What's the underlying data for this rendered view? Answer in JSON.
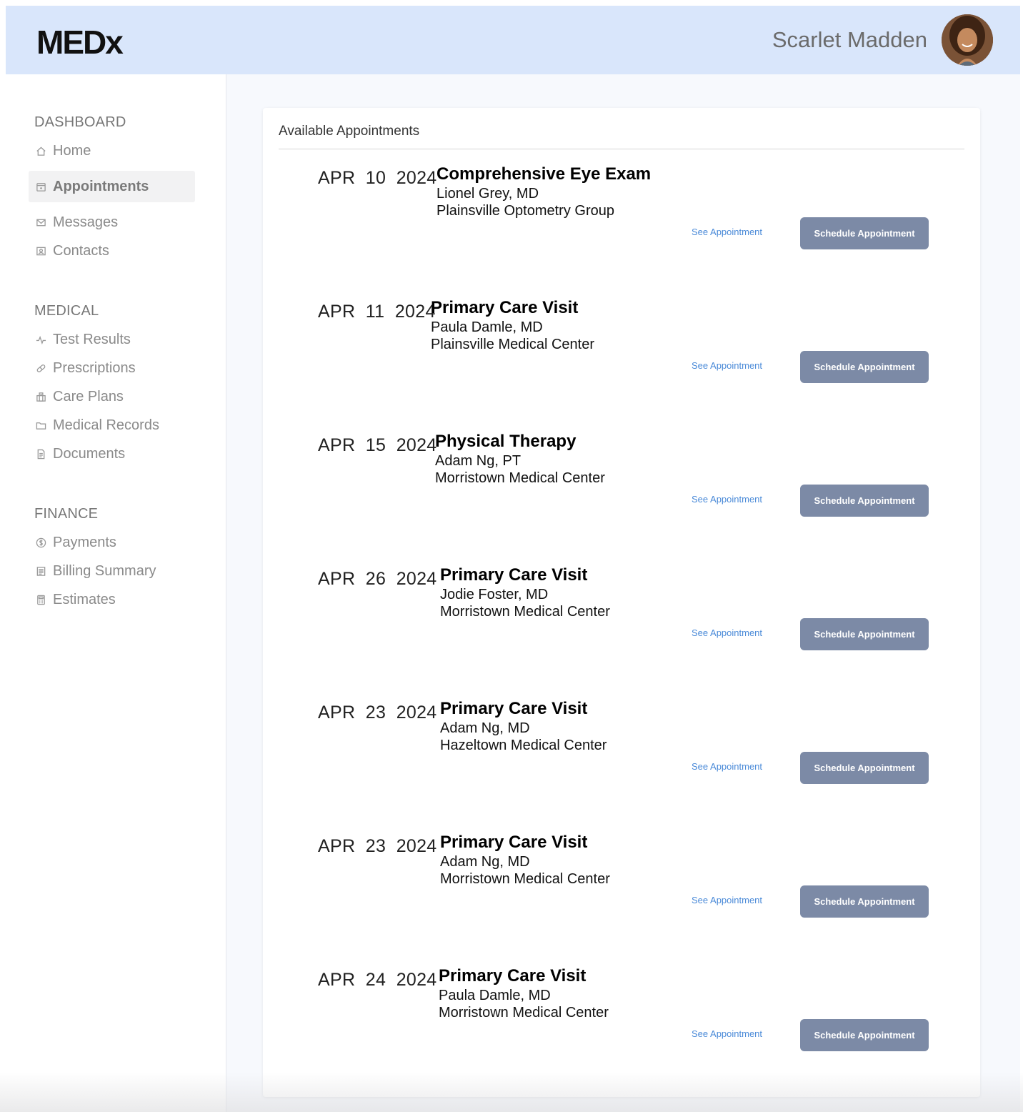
{
  "header": {
    "logo": "MEDx",
    "user_name": "Scarlet Madden",
    "avatar_icon": "user-avatar"
  },
  "sidebar": {
    "sections": [
      {
        "title": "DASHBOARD",
        "items": [
          {
            "label": "Home",
            "icon": "home-icon",
            "active": false
          },
          {
            "label": "Appointments",
            "icon": "calendar-icon",
            "active": true
          },
          {
            "label": "Messages",
            "icon": "mail-icon",
            "active": false
          },
          {
            "label": "Contacts",
            "icon": "contact-card-icon",
            "active": false
          }
        ]
      },
      {
        "title": "MEDICAL",
        "items": [
          {
            "label": "Test Results",
            "icon": "pulse-icon",
            "active": false
          },
          {
            "label": "Prescriptions",
            "icon": "pill-icon",
            "active": false
          },
          {
            "label": "Care Plans",
            "icon": "hospital-icon",
            "active": false
          },
          {
            "label": "Medical Records",
            "icon": "folder-icon",
            "active": false
          },
          {
            "label": "Documents",
            "icon": "document-icon",
            "active": false
          }
        ]
      },
      {
        "title": "FINANCE",
        "items": [
          {
            "label": "Payments",
            "icon": "dollar-coin-icon",
            "active": false
          },
          {
            "label": "Billing Summary",
            "icon": "receipt-icon",
            "active": false
          },
          {
            "label": "Estimates",
            "icon": "calculator-icon",
            "active": false
          }
        ]
      }
    ]
  },
  "main": {
    "card_title": "Available Appointments",
    "see_label": "See Appointment",
    "schedule_label": "Schedule Appointment",
    "appointments": [
      {
        "date": "APR  10  2024",
        "type": "Comprehensive Eye Exam",
        "doctor": "Lionel Grey, MD",
        "location": "Plainsville Optometry Group"
      },
      {
        "date": "APR  11  2024",
        "type": "Primary Care Visit",
        "doctor": "Paula Damle, MD",
        "location": "Plainsville Medical Center"
      },
      {
        "date": "APR  15  2024",
        "type": "Physical Therapy",
        "doctor": "Adam Ng, PT",
        "location": "Morristown Medical Center"
      },
      {
        "date": "APR  26  2024",
        "type": "Primary Care Visit",
        "doctor": "Jodie Foster, MD",
        "location": "Morristown Medical Center"
      },
      {
        "date": "APR  23  2024",
        "type": "Primary Care Visit",
        "doctor": "Adam Ng, MD",
        "location": "Hazeltown Medical Center"
      },
      {
        "date": "APR  23  2024",
        "type": "Primary Care Visit",
        "doctor": "Adam Ng, MD",
        "location": "Morristown Medical Center"
      },
      {
        "date": "APR  24  2024",
        "type": "Primary Care Visit",
        "doctor": "Paula Damle, MD",
        "location": "Morristown Medical Center"
      }
    ]
  },
  "colors": {
    "header_bg": "#d9e6fb",
    "main_bg": "#f7f9fd",
    "button_bg": "#7c8aa6",
    "link": "#4a8ad8"
  }
}
